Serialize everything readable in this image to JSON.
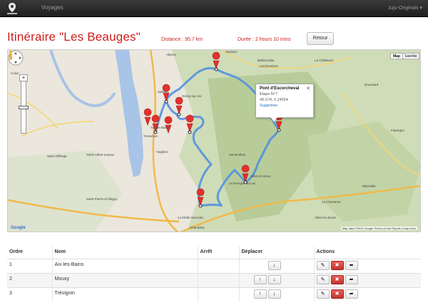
{
  "navbar": {
    "brand": "Voyages",
    "user": "Juju-Originals"
  },
  "header": {
    "title": "Itinéraire \"Les Beauges\"",
    "distance": "Distance : 95.7 km",
    "duration": "Durée : 2 hours 10 mins",
    "back_label": "Retour"
  },
  "map": {
    "type_map": "Map",
    "type_satellite": "Satellite",
    "footer": "Map data ©2013 Google   Terms of Use   Report a map error",
    "logo": "Google",
    "info_window": {
      "title": "Pont d'Escorcheval",
      "step": "Étape N°7",
      "coords": "45.674, 6.14554",
      "delete": "Supprimer"
    },
    "route_color": "#4a8de0",
    "marker_color": "#e3312e",
    "places": [
      "Albens",
      "Seyssel",
      "Culoz",
      "Sallerin",
      "Grésy-sur-Aix",
      "Aix-les-Bains",
      "Tresserve",
      "Voglans",
      "Chambéry",
      "Bellecombe",
      "Lescheraines",
      "Le Châtelard",
      "Doussard",
      "Faverges",
      "Albertville",
      "Saint-Pierre-d'Albigny",
      "La Motte-Servolex",
      "Saint-Alban-Leysse",
      "Le Bourget-du-Lac",
      "Aillon-le-Vieux",
      "Aillon-le-Jeune",
      "Montmélian",
      "Saint-Offenge",
      "La Chavanne"
    ]
  },
  "table": {
    "headers": {
      "ordre": "Ordre",
      "nom": "Nom",
      "arret": "Arrêt",
      "deplacer": "Déplacer",
      "actions": "Actions"
    },
    "rows": [
      {
        "ordre": "1",
        "nom": "Aix-les-Bains",
        "arret": ""
      },
      {
        "ordre": "2",
        "nom": "Mouxy",
        "arret": ""
      },
      {
        "ordre": "3",
        "nom": "Trévignin",
        "arret": ""
      }
    ]
  }
}
